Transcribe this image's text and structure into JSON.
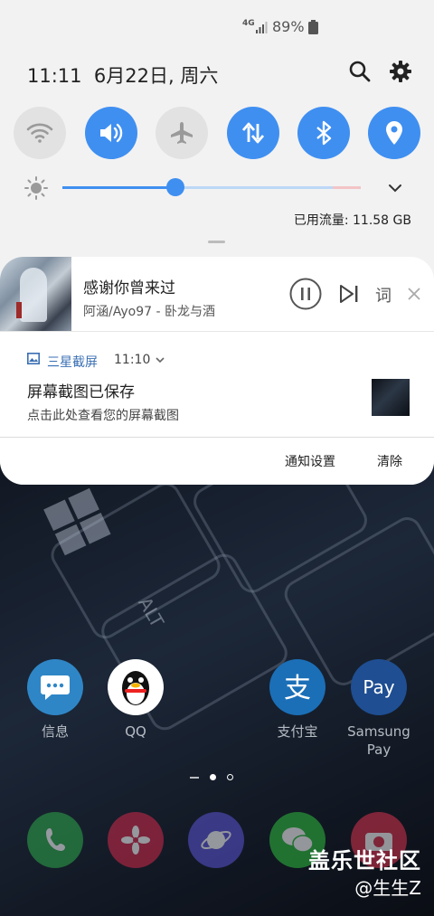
{
  "status_bar": {
    "network": "4G",
    "battery": "89%"
  },
  "header": {
    "time": "11:11",
    "date": "6月22日, 周六",
    "search_icon": "search-icon",
    "settings_icon": "gear-icon"
  },
  "quick_toggles": [
    {
      "name": "wifi",
      "icon": "wifi-icon",
      "on": false
    },
    {
      "name": "sound",
      "icon": "volume-icon",
      "on": true
    },
    {
      "name": "airplane",
      "icon": "airplane-icon",
      "on": false
    },
    {
      "name": "mobile-data",
      "icon": "data-icon",
      "on": true
    },
    {
      "name": "bluetooth",
      "icon": "bluetooth-icon",
      "on": true
    },
    {
      "name": "location",
      "icon": "location-icon",
      "on": true
    }
  ],
  "brightness": {
    "level": 0.38
  },
  "data_usage": "已用流量: 11.58 GB",
  "media": {
    "song": "感谢你曾来过",
    "artist": "阿涵/Ayo97 - 卧龙与酒",
    "lyrics_button": "词"
  },
  "notification": {
    "app": "三星截屏",
    "time": "11:10",
    "title": "屏幕截图已保存",
    "text": "点击此处查看您的屏幕截图"
  },
  "actions": {
    "settings": "通知设置",
    "clear": "清除"
  },
  "home_apps": [
    {
      "label": "信息"
    },
    {
      "label": "QQ"
    },
    {
      "label": "支付宝"
    },
    {
      "label": "Samsung Pay"
    }
  ],
  "watermark": {
    "line1": "盖乐世社区",
    "line2": "@生生Z"
  },
  "colors": {
    "accent": "#3f8ff1",
    "panel_bg": "#f2f2f2"
  }
}
